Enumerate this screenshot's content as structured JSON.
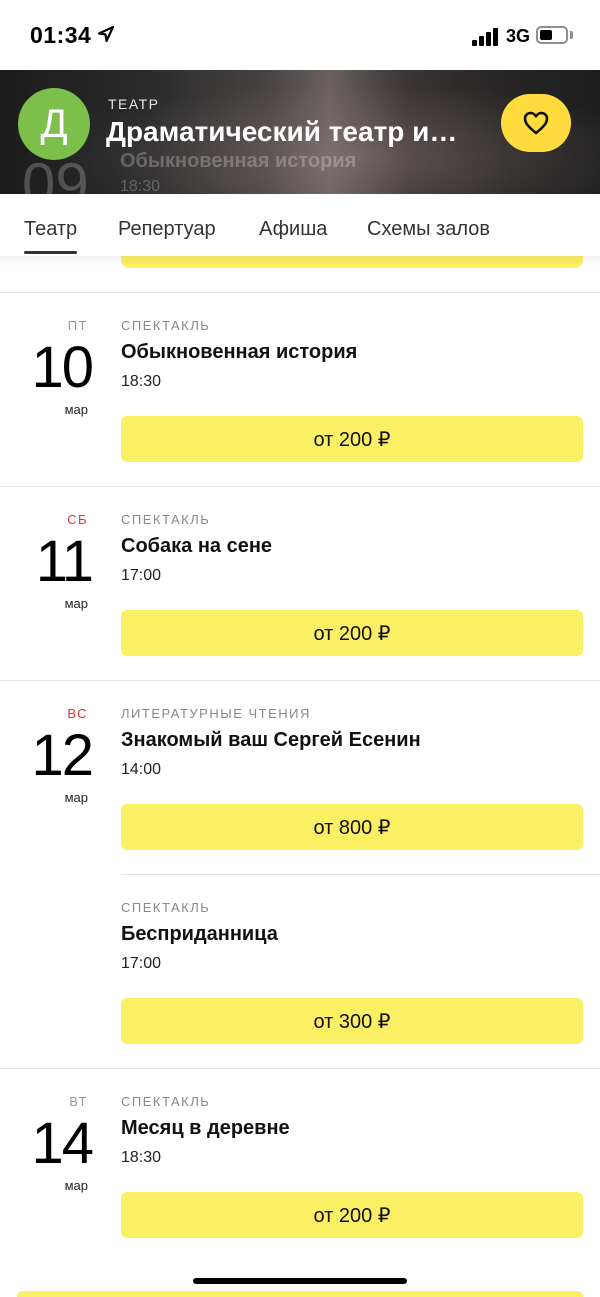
{
  "status": {
    "time": "01:34",
    "network": "3G"
  },
  "header": {
    "avatar_letter": "Д",
    "kicker": "ТЕАТР",
    "title": "Драматический театр имени...",
    "ghost_day": "09",
    "ghost_title": "Обыкновенная история",
    "ghost_time": "18:30"
  },
  "tabs": [
    {
      "label": "Театр",
      "active": true
    },
    {
      "label": "Репертуар",
      "active": false
    },
    {
      "label": "Афиша",
      "active": false
    },
    {
      "label": "Схемы залов",
      "active": false
    }
  ],
  "events": [
    {
      "dow": "ПТ",
      "day": "10",
      "month": "мар",
      "weekend": false,
      "shows": [
        {
          "type": "СПЕКТАКЛЬ",
          "title": "Обыкновенная история",
          "time": "18:30",
          "price": "от 200 ₽"
        }
      ]
    },
    {
      "dow": "СБ",
      "day": "11",
      "month": "мар",
      "weekend": true,
      "shows": [
        {
          "type": "СПЕКТАКЛЬ",
          "title": "Собака на сене",
          "time": "17:00",
          "price": "от 200 ₽"
        }
      ]
    },
    {
      "dow": "ВС",
      "day": "12",
      "month": "мар",
      "weekend": true,
      "shows": [
        {
          "type": "ЛИТЕРАТУРНЫЕ ЧТЕНИЯ",
          "title": "Знакомый ваш Сергей Есенин",
          "time": "14:00",
          "price": "от 800 ₽"
        },
        {
          "type": "СПЕКТАКЛЬ",
          "title": "Бесприданница",
          "time": "17:00",
          "price": "от 300 ₽"
        }
      ]
    },
    {
      "dow": "ВТ",
      "day": "14",
      "month": "мар",
      "weekend": false,
      "shows": [
        {
          "type": "СПЕКТАКЛЬ",
          "title": "Месяц в деревне",
          "time": "18:30",
          "price": "от 200 ₽"
        }
      ]
    }
  ],
  "colors": {
    "accent_yellow": "#fbf063",
    "weekend_red": "#e0352b",
    "avatar_green": "#7cbf4a"
  }
}
